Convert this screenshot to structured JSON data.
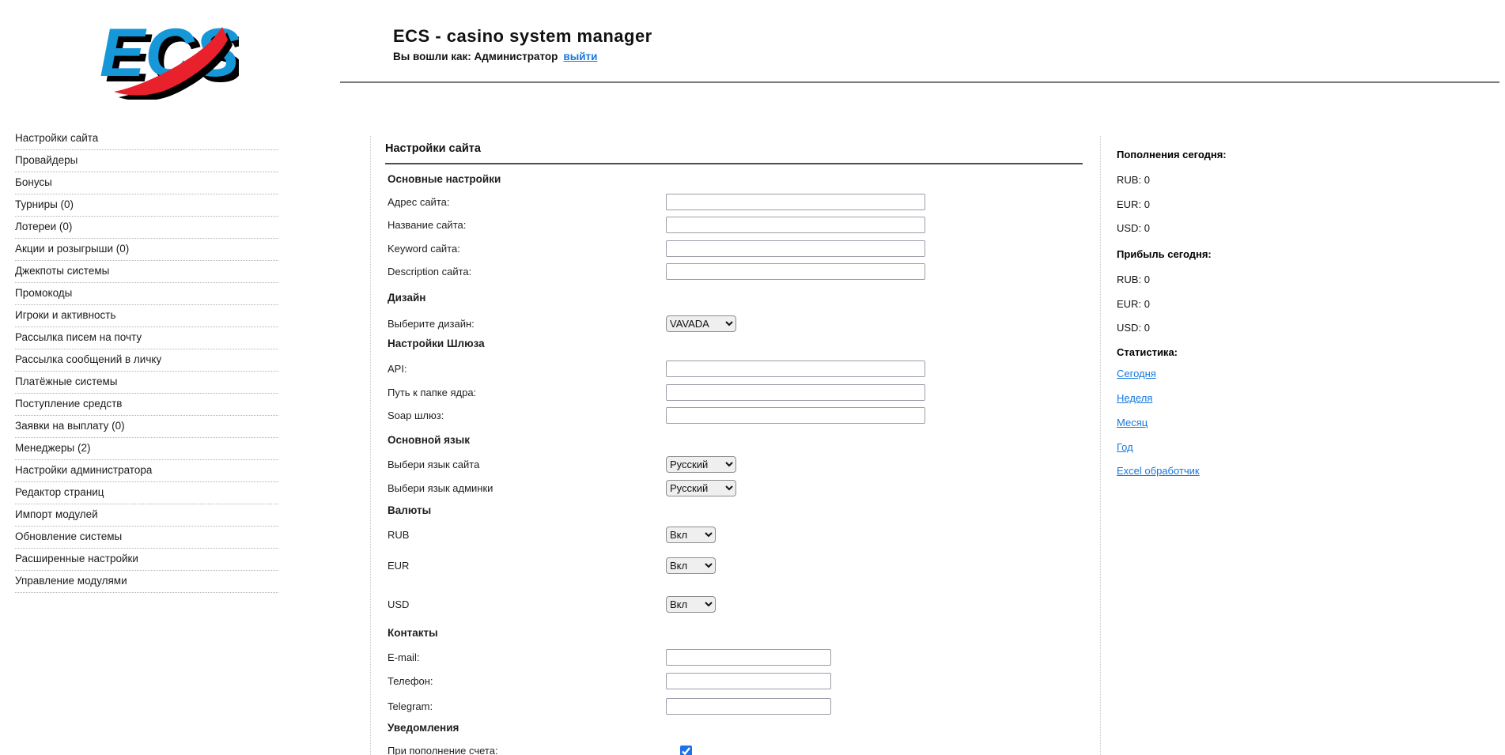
{
  "header": {
    "logo_text": "ECS",
    "title": "ECS - casino system manager",
    "login_prefix": "Вы вошли как: Администратор",
    "logout_label": "выйти",
    "brand_blue": "#1697d8",
    "brand_red": "#e8212d",
    "link_blue": "#1778e0"
  },
  "sidebar": {
    "items": [
      "Настройки сайта",
      "Провайдеры",
      "Бонусы",
      "Турниры (0)",
      "Лотереи (0)",
      "Акции и розыгрыши (0)",
      "Джекпоты системы",
      "Промокоды",
      "Игроки и активность",
      "Рассылка писем на почту",
      "Рассылка сообщений в личку",
      "Платёжные системы",
      "Поступление средств",
      "Заявки на выплату (0)",
      "Менеджеры (2)",
      "Настройки администратора",
      "Редактор страниц",
      "Импорт модулей",
      "Обновление системы",
      "Расширенные настройки",
      "Управление модулями"
    ]
  },
  "main": {
    "title": "Настройки сайта",
    "headings": {
      "basic": "Основные настройки",
      "design": "Дизайн",
      "gateway": "Настройки Шлюза",
      "language": "Основной язык",
      "currencies": "Валюты",
      "contacts": "Контакты",
      "notifications": "Уведомления"
    },
    "fields": {
      "site_address": {
        "label": "Адрес сайта:",
        "value": ""
      },
      "site_name": {
        "label": "Название сайта:",
        "value": ""
      },
      "site_keyword": {
        "label": "Keyword сайта:",
        "value": ""
      },
      "site_description": {
        "label": "Description сайта:",
        "value": ""
      },
      "design": {
        "label": "Выберите дизайн:",
        "value": "VAVADA"
      },
      "api": {
        "label": "API:",
        "value": ""
      },
      "core_path": {
        "label": "Путь к папке ядра:",
        "value": ""
      },
      "soap_gateway": {
        "label": "Soap шлюз:",
        "value": ""
      },
      "site_lang": {
        "label": "Выбери язык сайта",
        "value": "Русский"
      },
      "admin_lang": {
        "label": "Выбери язык админки",
        "value": "Русский"
      },
      "rub": {
        "label": "RUB",
        "value": "Вкл"
      },
      "eur": {
        "label": "EUR",
        "value": "Вкл"
      },
      "usd": {
        "label": "USD",
        "value": "Вкл"
      },
      "email": {
        "label": "E-mail:",
        "value": ""
      },
      "phone": {
        "label": "Телефон:",
        "value": ""
      },
      "telegram": {
        "label": "Telegram:",
        "value": ""
      },
      "deposit_notify": {
        "label": "При пополнение счета:",
        "checked": true
      }
    }
  },
  "right_panel": {
    "deposits_heading": "Пополнения сегодня:",
    "deposits": [
      {
        "currency": "RUB:",
        "amount": "0"
      },
      {
        "currency": "EUR:",
        "amount": "0"
      },
      {
        "currency": "USD:",
        "amount": "0"
      }
    ],
    "profit_heading": "Прибыль сегодня:",
    "profit": [
      {
        "currency": "RUB:",
        "amount": "0"
      },
      {
        "currency": "EUR:",
        "amount": "0"
      },
      {
        "currency": "USD:",
        "amount": "0"
      }
    ],
    "stats_heading": "Статистика:",
    "stats_links": [
      "Сегодня",
      "Неделя",
      "Месяц",
      "Год",
      "Excel обработчик"
    ]
  }
}
